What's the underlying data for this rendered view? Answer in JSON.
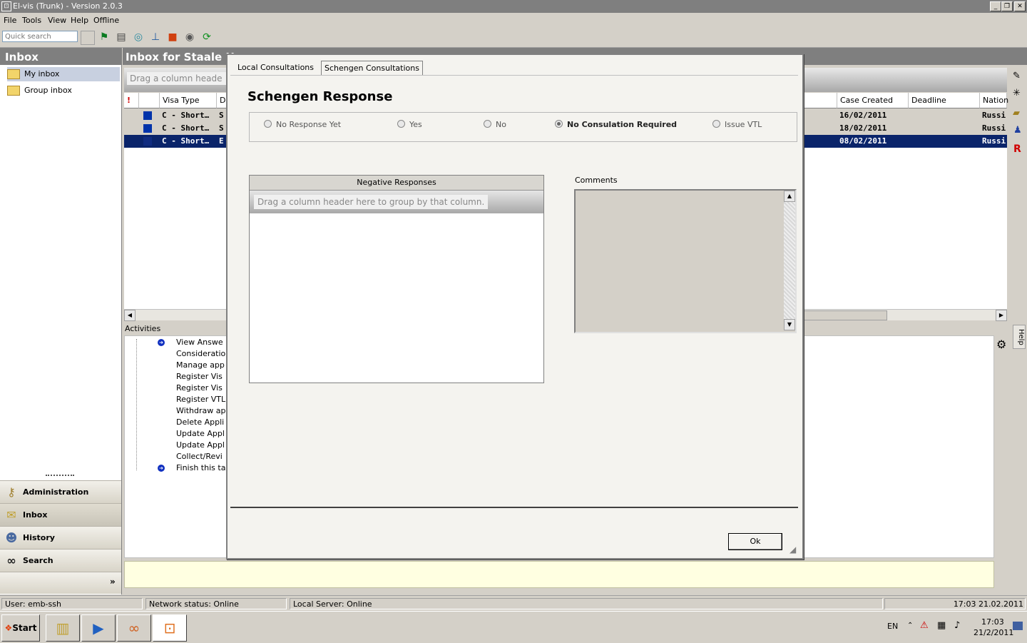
{
  "window": {
    "title": "El-vis (Trunk) - Version 2.0.3"
  },
  "menu": [
    "File",
    "Tools",
    "View",
    "Help",
    "Offline"
  ],
  "toolbar": {
    "search_placeholder": "Quick search"
  },
  "left": {
    "header": "Inbox",
    "tree": [
      "My inbox",
      "Group inbox"
    ],
    "nav": [
      "Administration",
      "Inbox",
      "History",
      "Search"
    ]
  },
  "main": {
    "header": "Inbox for Staale He",
    "drag_hint": "Drag a column heade",
    "columns": {
      "flag": "!",
      "visa_type": "Visa Type",
      "d": "D",
      "case_created": "Case Created",
      "deadline": "Deadline",
      "nation": "Nation"
    },
    "rows": [
      {
        "visa_type": "C - Short…",
        "d": "S",
        "case_created": "16/02/2011",
        "deadline": "",
        "nation": "Russi"
      },
      {
        "visa_type": "C - Short…",
        "d": "S",
        "case_created": "18/02/2011",
        "deadline": "",
        "nation": "Russi"
      },
      {
        "visa_type": "C - Short…",
        "d": "E",
        "case_created": "08/02/2011",
        "deadline": "",
        "nation": "Russi"
      }
    ],
    "activities_label": "Activities",
    "activities": [
      "View Answe",
      "Consideratio",
      "Manage app",
      "Register Vis",
      "Register Vis",
      "Register VTL",
      "Withdraw ap",
      "Delete Appli",
      "Update Appl",
      "Update Appl",
      "Collect/Revi",
      "Finish this ta"
    ],
    "help_tab": "Help"
  },
  "dialog": {
    "tabs": [
      "Local Consultations",
      "Schengen Consultations"
    ],
    "active_tab": "Schengen Consultations",
    "title": "Schengen Response",
    "options": [
      "No Response Yet",
      "Yes",
      "No",
      "No Consulation Required",
      "Issue VTL"
    ],
    "selected_option": "No Consulation Required",
    "negative_header": "Negative Responses",
    "negative_drag": "Drag a column header here to group by that column.",
    "comments_label": "Comments",
    "ok_label": "Ok"
  },
  "status": {
    "user": "User: emb-ssh",
    "network": "Network status: Online",
    "server": "Local Server:  Online",
    "datetime": "17:03 21.02.2011"
  },
  "taskbar": {
    "start": "Start",
    "lang": "EN",
    "time": "17:03",
    "date": "21/2/2011"
  }
}
